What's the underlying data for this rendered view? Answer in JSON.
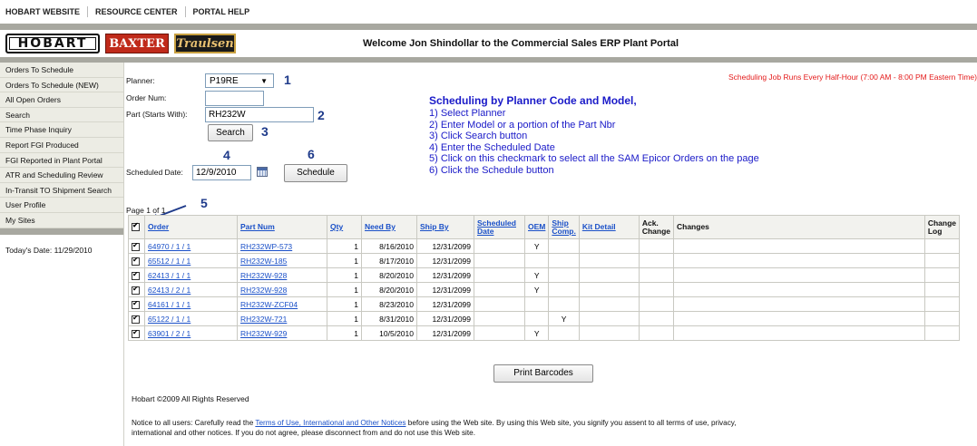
{
  "topnav": {
    "items": [
      "HOBART WEBSITE",
      "RESOURCE CENTER",
      "PORTAL HELP"
    ]
  },
  "header": {
    "logos": [
      "HOBART",
      "BAXTER",
      "Traulsen"
    ],
    "welcome": "Welcome Jon Shindollar to the Commercial Sales ERP Plant Portal"
  },
  "sidebar": {
    "items": [
      "Orders To Schedule",
      "Orders To Schedule (NEW)",
      "All Open Orders",
      "Search",
      "Time Phase Inquiry",
      "Report FGI Produced",
      "FGI Reported in Plant Portal",
      "ATR and Scheduling Review",
      "In-Transit TO Shipment Search",
      "User Profile",
      "My Sites"
    ],
    "today": "Today's Date: 11/29/2010"
  },
  "form": {
    "planner_label": "Planner:",
    "planner_value": "P19RE",
    "order_num_label": "Order Num:",
    "order_num_value": "",
    "part_label": "Part (Starts With):",
    "part_value": "RH232W",
    "search_button": "Search",
    "scheduled_date_label": "Scheduled Date:",
    "scheduled_date_value": "12/9/2010",
    "schedule_button": "Schedule"
  },
  "callouts": [
    "1",
    "2",
    "3",
    "4",
    "5",
    "6"
  ],
  "schedule_note": "Scheduling Job Runs Every Half-Hour (7:00 AM - 8:00 PM Eastern Time)",
  "instructions": {
    "title": "Scheduling by Planner Code and Model,",
    "steps": [
      "1) Select Planner",
      "2) Enter Model or a portion of the Part Nbr",
      "3) Click Search button",
      "4) Enter the Scheduled Date",
      "5) Click on this checkmark to select all the SAM Epicor Orders on the page",
      "6) Click the Schedule button"
    ]
  },
  "table": {
    "page_label": "Page 1 of 1",
    "headers": {
      "order": "Order",
      "part_num": "Part Num",
      "qty": "Qty",
      "need_by": "Need By",
      "ship_by": "Ship By",
      "scheduled_date": "Scheduled Date",
      "oem": "OEM",
      "ship_comp": "Ship Comp.",
      "kit_detail": "Kit Detail",
      "ack_change": "Ack. Change",
      "changes": "Changes",
      "change_log": "Change Log"
    },
    "rows": [
      {
        "order": "64970 / 1 / 1",
        "part": "RH232WP-573",
        "qty": "1",
        "need_by": "8/16/2010",
        "ship_by": "12/31/2099",
        "scheduled": "",
        "oem": "Y",
        "ship_comp": ""
      },
      {
        "order": "65512 / 1 / 1",
        "part": "RH232W-185",
        "qty": "1",
        "need_by": "8/17/2010",
        "ship_by": "12/31/2099",
        "scheduled": "",
        "oem": "",
        "ship_comp": ""
      },
      {
        "order": "62413 / 1 / 1",
        "part": "RH232W-928",
        "qty": "1",
        "need_by": "8/20/2010",
        "ship_by": "12/31/2099",
        "scheduled": "",
        "oem": "Y",
        "ship_comp": ""
      },
      {
        "order": "62413 / 2 / 1",
        "part": "RH232W-928",
        "qty": "1",
        "need_by": "8/20/2010",
        "ship_by": "12/31/2099",
        "scheduled": "",
        "oem": "Y",
        "ship_comp": ""
      },
      {
        "order": "64161 / 1 / 1",
        "part": "RH232W-ZCF04",
        "qty": "1",
        "need_by": "8/23/2010",
        "ship_by": "12/31/2099",
        "scheduled": "",
        "oem": "",
        "ship_comp": ""
      },
      {
        "order": "65122 / 1 / 1",
        "part": "RH232W-721",
        "qty": "1",
        "need_by": "8/31/2010",
        "ship_by": "12/31/2099",
        "scheduled": "",
        "oem": "",
        "ship_comp": "Y"
      },
      {
        "order": "63901 / 2 / 1",
        "part": "RH232W-929",
        "qty": "1",
        "need_by": "10/5/2010",
        "ship_by": "12/31/2099",
        "scheduled": "",
        "oem": "Y",
        "ship_comp": ""
      }
    ]
  },
  "print_button": "Print Barcodes",
  "footer": {
    "copyright": "Hobart ©2009 All Rights Reserved",
    "notice_before": "Notice to all users: Carefully read the ",
    "notice_link": "Terms of Use, International and Other Notices",
    "notice_after": " before using the Web site. By using this Web site, you signify you assent to all terms of use, privacy, international and other notices. If you do not agree, please disconnect from and do not use this Web site."
  },
  "colors": {
    "link": "#1a50c8",
    "instructions": "#1a1ac8",
    "note": "#e41b1b",
    "bar": "#a8a8a0"
  }
}
